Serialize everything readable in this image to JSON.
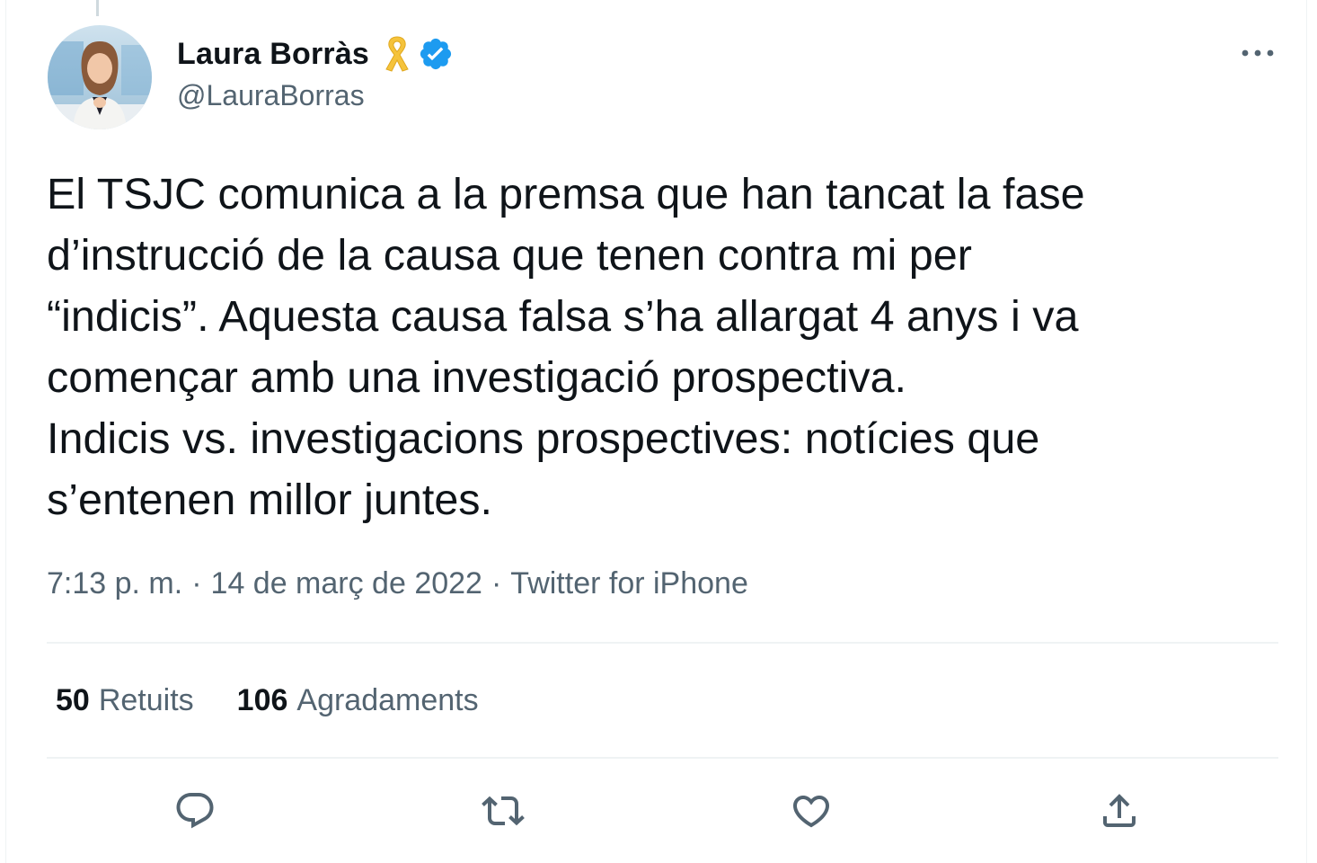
{
  "author": {
    "display_name": "Laura Borràs",
    "handle": "@LauraBorras",
    "avatar_icon": "profile-photo",
    "badges": [
      "yellow-ribbon-icon",
      "verified-badge-icon"
    ]
  },
  "tweet": {
    "text": "El TSJC comunica a la premsa que han tancat la fase\nd’instrucció de la causa que tenen contra mi per\n“indicis”. Aquesta causa falsa s’ha allargat 4 anys i va\ncomençar amb una investigació prospectiva.\nIndicis vs. investigacions prospectives: notícies que\ns’entenen millor juntes."
  },
  "meta": {
    "time": "7:13 p. m.",
    "separator": "·",
    "date": "14 de març de 2022",
    "source": "Twitter for iPhone"
  },
  "stats": {
    "retweets_count": "50",
    "retweets_label": "Retuits",
    "likes_count": "106",
    "likes_label": "Agradaments"
  },
  "actions": [
    "reply-icon",
    "retweet-icon",
    "like-icon",
    "share-icon"
  ],
  "colors": {
    "text_primary": "#0f1419",
    "text_secondary": "#536471",
    "verified_blue": "#1d9bf0",
    "ribbon_yellow": "#f5c33b",
    "divider": "#eff3f4"
  }
}
